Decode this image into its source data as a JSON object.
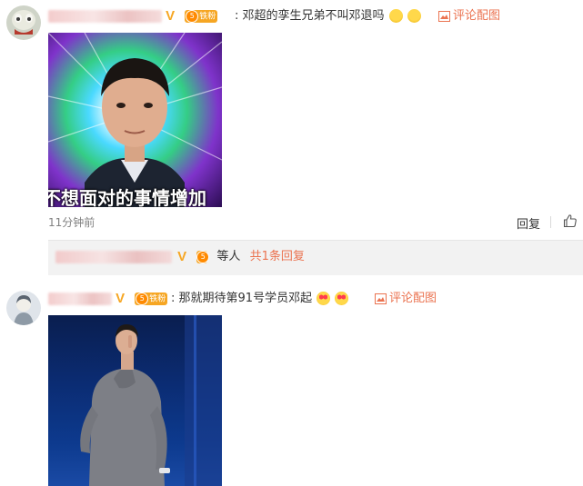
{
  "comments": [
    {
      "verified_icon": "v-badge-icon",
      "fan_badge": "铁粉",
      "fan_level": "5",
      "text": "邓超的孪生兄弟不叫邓退吗",
      "emojis": [
        "crying-face-icon",
        "crying-face-icon"
      ],
      "comment_with_image_link": "评论配图",
      "image_caption": "不想面对的事情增加",
      "time": "11分钟前",
      "reply_label": "回复",
      "like_icon": "thumb-up-icon"
    },
    {
      "verified_icon": "v-badge-icon",
      "fan_badge": "铁粉",
      "fan_level": "5",
      "text": "那就期待第91号学员邓起",
      "emojis": [
        "heart-eyes-icon",
        "heart-eyes-icon"
      ],
      "comment_with_image_link": "评论配图"
    }
  ],
  "sub_reply": {
    "text": "等人",
    "total_replies": "共1条回复"
  },
  "colors": {
    "accent": "#eb7350",
    "verified": "#f6a623",
    "reply_bg": "#f2f2f2"
  }
}
